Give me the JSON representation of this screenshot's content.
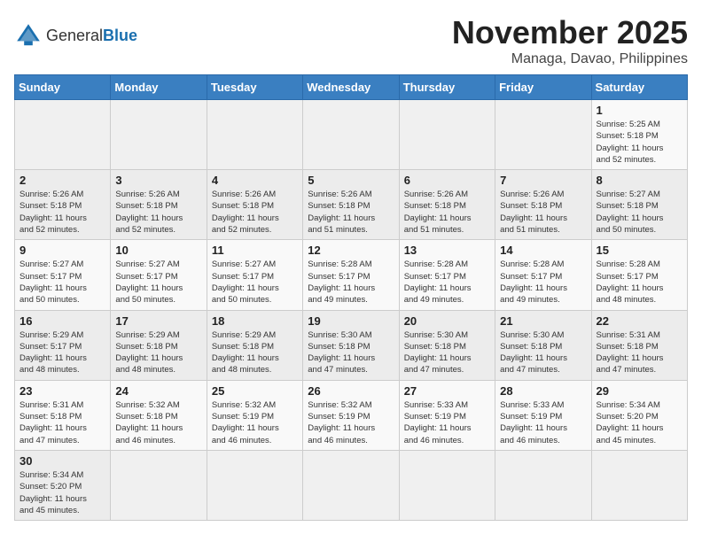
{
  "header": {
    "logo": {
      "general": "General",
      "blue": "Blue"
    },
    "title": "November 2025",
    "location": "Managa, Davao, Philippines"
  },
  "weekdays": [
    "Sunday",
    "Monday",
    "Tuesday",
    "Wednesday",
    "Thursday",
    "Friday",
    "Saturday"
  ],
  "weeks": [
    [
      {
        "day": null
      },
      {
        "day": null
      },
      {
        "day": null
      },
      {
        "day": null
      },
      {
        "day": null
      },
      {
        "day": null
      },
      {
        "day": 1,
        "sunrise": "5:25 AM",
        "sunset": "5:18 PM",
        "daylight": "11 hours and 52 minutes."
      }
    ],
    [
      {
        "day": 2,
        "sunrise": "5:26 AM",
        "sunset": "5:18 PM",
        "daylight": "11 hours and 52 minutes."
      },
      {
        "day": 3,
        "sunrise": "5:26 AM",
        "sunset": "5:18 PM",
        "daylight": "11 hours and 52 minutes."
      },
      {
        "day": 4,
        "sunrise": "5:26 AM",
        "sunset": "5:18 PM",
        "daylight": "11 hours and 52 minutes."
      },
      {
        "day": 5,
        "sunrise": "5:26 AM",
        "sunset": "5:18 PM",
        "daylight": "11 hours and 51 minutes."
      },
      {
        "day": 6,
        "sunrise": "5:26 AM",
        "sunset": "5:18 PM",
        "daylight": "11 hours and 51 minutes."
      },
      {
        "day": 7,
        "sunrise": "5:26 AM",
        "sunset": "5:18 PM",
        "daylight": "11 hours and 51 minutes."
      },
      {
        "day": 8,
        "sunrise": "5:27 AM",
        "sunset": "5:18 PM",
        "daylight": "11 hours and 50 minutes."
      }
    ],
    [
      {
        "day": 9,
        "sunrise": "5:27 AM",
        "sunset": "5:17 PM",
        "daylight": "11 hours and 50 minutes."
      },
      {
        "day": 10,
        "sunrise": "5:27 AM",
        "sunset": "5:17 PM",
        "daylight": "11 hours and 50 minutes."
      },
      {
        "day": 11,
        "sunrise": "5:27 AM",
        "sunset": "5:17 PM",
        "daylight": "11 hours and 50 minutes."
      },
      {
        "day": 12,
        "sunrise": "5:28 AM",
        "sunset": "5:17 PM",
        "daylight": "11 hours and 49 minutes."
      },
      {
        "day": 13,
        "sunrise": "5:28 AM",
        "sunset": "5:17 PM",
        "daylight": "11 hours and 49 minutes."
      },
      {
        "day": 14,
        "sunrise": "5:28 AM",
        "sunset": "5:17 PM",
        "daylight": "11 hours and 49 minutes."
      },
      {
        "day": 15,
        "sunrise": "5:28 AM",
        "sunset": "5:17 PM",
        "daylight": "11 hours and 48 minutes."
      }
    ],
    [
      {
        "day": 16,
        "sunrise": "5:29 AM",
        "sunset": "5:17 PM",
        "daylight": "11 hours and 48 minutes."
      },
      {
        "day": 17,
        "sunrise": "5:29 AM",
        "sunset": "5:18 PM",
        "daylight": "11 hours and 48 minutes."
      },
      {
        "day": 18,
        "sunrise": "5:29 AM",
        "sunset": "5:18 PM",
        "daylight": "11 hours and 48 minutes."
      },
      {
        "day": 19,
        "sunrise": "5:30 AM",
        "sunset": "5:18 PM",
        "daylight": "11 hours and 47 minutes."
      },
      {
        "day": 20,
        "sunrise": "5:30 AM",
        "sunset": "5:18 PM",
        "daylight": "11 hours and 47 minutes."
      },
      {
        "day": 21,
        "sunrise": "5:30 AM",
        "sunset": "5:18 PM",
        "daylight": "11 hours and 47 minutes."
      },
      {
        "day": 22,
        "sunrise": "5:31 AM",
        "sunset": "5:18 PM",
        "daylight": "11 hours and 47 minutes."
      }
    ],
    [
      {
        "day": 23,
        "sunrise": "5:31 AM",
        "sunset": "5:18 PM",
        "daylight": "11 hours and 47 minutes."
      },
      {
        "day": 24,
        "sunrise": "5:32 AM",
        "sunset": "5:18 PM",
        "daylight": "11 hours and 46 minutes."
      },
      {
        "day": 25,
        "sunrise": "5:32 AM",
        "sunset": "5:19 PM",
        "daylight": "11 hours and 46 minutes."
      },
      {
        "day": 26,
        "sunrise": "5:32 AM",
        "sunset": "5:19 PM",
        "daylight": "11 hours and 46 minutes."
      },
      {
        "day": 27,
        "sunrise": "5:33 AM",
        "sunset": "5:19 PM",
        "daylight": "11 hours and 46 minutes."
      },
      {
        "day": 28,
        "sunrise": "5:33 AM",
        "sunset": "5:19 PM",
        "daylight": "11 hours and 46 minutes."
      },
      {
        "day": 29,
        "sunrise": "5:34 AM",
        "sunset": "5:20 PM",
        "daylight": "11 hours and 45 minutes."
      }
    ],
    [
      {
        "day": 30,
        "sunrise": "5:34 AM",
        "sunset": "5:20 PM",
        "daylight": "11 hours and 45 minutes."
      },
      {
        "day": null
      },
      {
        "day": null
      },
      {
        "day": null
      },
      {
        "day": null
      },
      {
        "day": null
      },
      {
        "day": null
      }
    ]
  ],
  "labels": {
    "sunrise": "Sunrise:",
    "sunset": "Sunset:",
    "daylight": "Daylight:"
  }
}
